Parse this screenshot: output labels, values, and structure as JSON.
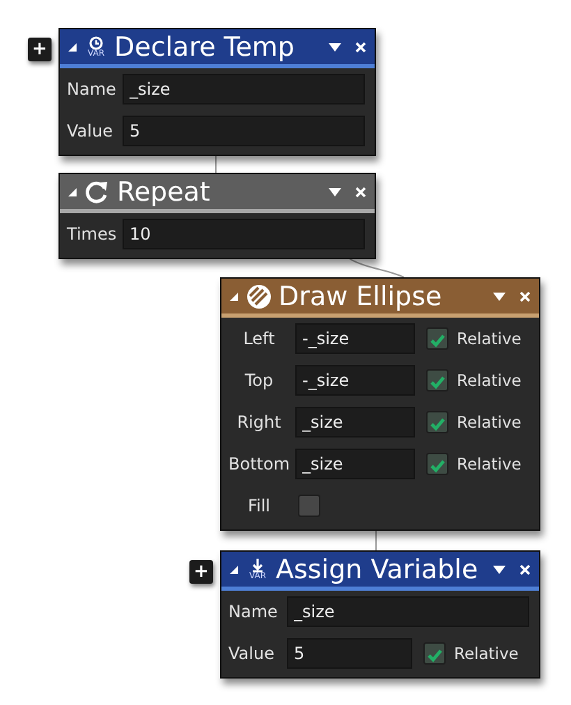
{
  "nodes": [
    {
      "title": "Declare Temp",
      "kind": "var-clock",
      "icon_caption": "VAR",
      "color": "#1f3d8c",
      "expanded": true,
      "add_button": "+",
      "rows": [
        {
          "kind": "field",
          "label": "Name",
          "value": "_size"
        },
        {
          "kind": "field",
          "label": "Value",
          "value": "5"
        }
      ]
    },
    {
      "title": "Repeat",
      "kind": "repeat",
      "color": "#5e5e5e",
      "expanded": true,
      "rows": [
        {
          "kind": "field",
          "label": "Times",
          "value": "10"
        }
      ]
    },
    {
      "title": "Draw Ellipse",
      "kind": "ellipse",
      "color": "#8a5e34",
      "expanded": true,
      "rows": [
        {
          "kind": "field",
          "label": "Left",
          "value": "-_size",
          "relative": {
            "label": "Relative",
            "checked": true
          }
        },
        {
          "kind": "field",
          "label": "Top",
          "value": "-_size",
          "relative": {
            "label": "Relative",
            "checked": true
          }
        },
        {
          "kind": "field",
          "label": "Right",
          "value": "_size",
          "relative": {
            "label": "Relative",
            "checked": true
          }
        },
        {
          "kind": "field",
          "label": "Bottom",
          "value": "_size",
          "relative": {
            "label": "Relative",
            "checked": true
          }
        },
        {
          "kind": "checkbox",
          "label": "Fill",
          "checked": false
        }
      ]
    },
    {
      "title": "Assign Variable",
      "kind": "var-arrow",
      "icon_caption": "VAR",
      "color": "#1f3d8c",
      "expanded": true,
      "add_button": "+",
      "rows": [
        {
          "kind": "field",
          "label": "Name",
          "value": "_size"
        },
        {
          "kind": "field",
          "label": "Value",
          "value": "5",
          "relative": {
            "label": "Relative",
            "checked": true
          }
        }
      ]
    }
  ]
}
